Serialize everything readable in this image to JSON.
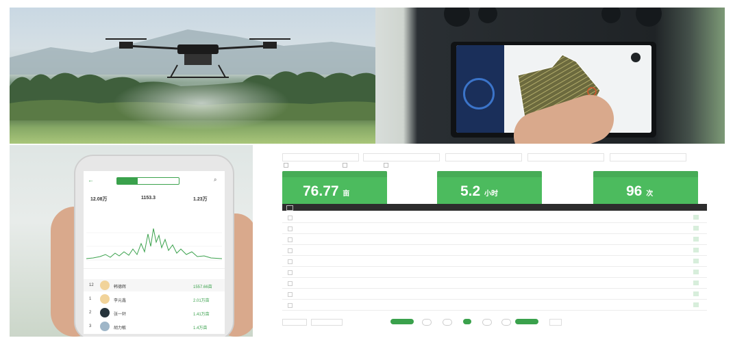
{
  "phone_app": {
    "stat_1": "12.08万",
    "stat_2": "1153.3",
    "stat_3": "1.23万",
    "ranking": [
      {
        "rank": "12",
        "name": "韩德辉",
        "value": "1557.66亩"
      },
      {
        "rank": "1",
        "name": "李元鑫",
        "value": "2.01万亩"
      },
      {
        "rank": "2",
        "name": "张一轩",
        "value": "1.41万亩"
      },
      {
        "rank": "3",
        "name": "胡力敏",
        "value": "1.4万亩"
      }
    ]
  },
  "dashboard": {
    "cards": [
      {
        "value": "76.77",
        "unit": "亩"
      },
      {
        "value": "5.2",
        "unit": "小时"
      },
      {
        "value": "96",
        "unit": "次"
      }
    ]
  },
  "colors": {
    "accent": "#4cbb5e",
    "header": "#2d2d2d"
  }
}
